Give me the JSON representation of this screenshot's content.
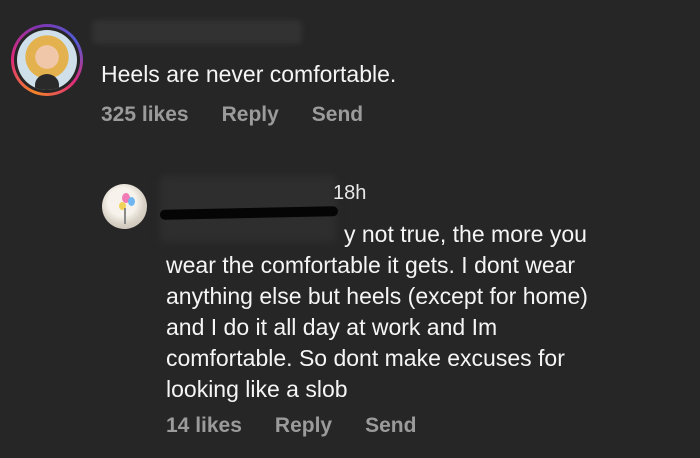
{
  "comment1": {
    "text": "Heels are never comfortable.",
    "likes": "325 likes",
    "reply_label": "Reply",
    "send_label": "Send"
  },
  "comment2": {
    "timestamp": "18h",
    "first_line_visible": "y not true, the more you",
    "lines": [
      "wear the comfortable it gets. I dont wear",
      "anything else but heels (except for home)",
      "and I do it all day at work and Im",
      "comfortable. So dont make excuses for",
      "looking like a slob"
    ],
    "likes": "14 likes",
    "reply_label": "Reply",
    "send_label": "Send"
  },
  "colors": {
    "background": "#262626",
    "text": "#f5f5f5",
    "meta_text": "#9b9b9b",
    "story_ring": [
      "#f58529",
      "#dd2a7b",
      "#8134af",
      "#515bd4"
    ]
  }
}
